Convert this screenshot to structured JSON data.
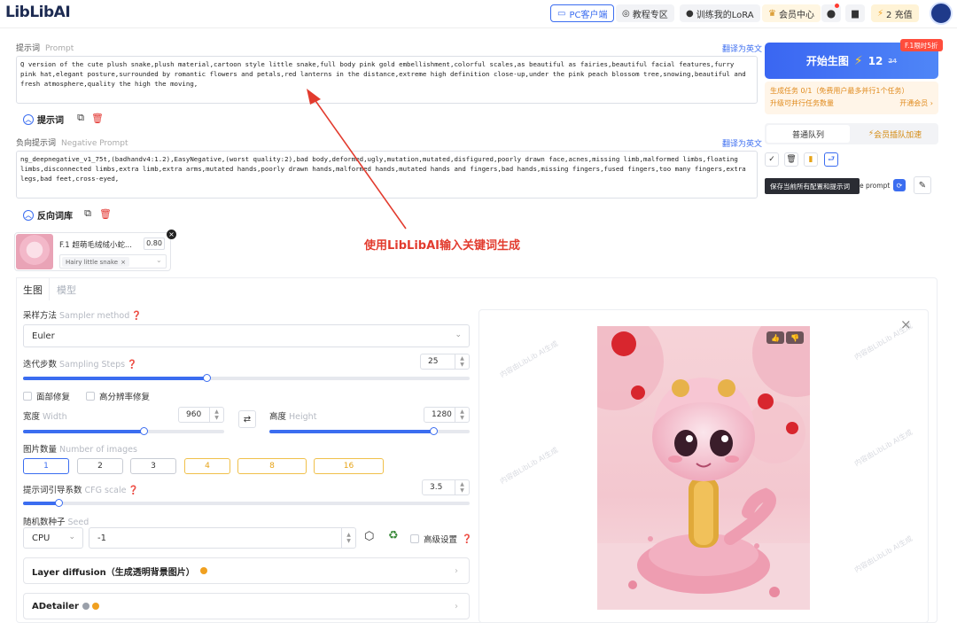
{
  "header": {
    "logo": "LibLibAI",
    "pc_client": "PC客户端",
    "tutorials": "教程专区",
    "train_lora": "训练我的LoRA",
    "member_center": "会员中心",
    "recharge": "2 充值"
  },
  "prompt": {
    "label": "提示词",
    "label_en": "Prompt",
    "translate": "翻译为英文",
    "text": "Q version of the cute plush snake,plush material,cartoon style little snake,full body pink gold embellishment,colorful scales,as beautiful as fairies,beautiful facial features,furry pink hat,elegant posture,surrounded by romantic flowers and petals,red lanterns in the distance,extreme high definition close-up,under the pink peach blossom tree,snowing,beautiful and fresh atmosphere,quality the high the moving,",
    "toolbar_label": "提示词"
  },
  "negative": {
    "label": "负向提示词",
    "label_en": "Negative Prompt",
    "translate": "翻译为英文",
    "text": "ng_deepnegative_v1_75t,(badhandv4:1.2),EasyNegative,(worst quality:2),bad body,deformed,ugly,mutation,mutated,disfigured,poorly drawn face,acnes,missing limb,malformed limbs,floating limbs,disconnected limbs,extra limb,extra arms,mutated hands,poorly drawn hands,malformed hands,mutated hands and fingers,bad hands,missing fingers,fused fingers,too many fingers,extra legs,bad feet,cross-eyed,",
    "toolbar_label": "反向词库"
  },
  "lora": {
    "name": "F.1 超萌毛绒绒小蛇...",
    "weight": "0.80",
    "tag": "Hairy little snake"
  },
  "tabs": [
    "生图",
    "模型"
  ],
  "params": {
    "sampler_label": "采样方法",
    "sampler_label_en": "Sampler method",
    "sampler_value": "Euler",
    "steps_label": "迭代步数",
    "steps_label_en": "Sampling Steps",
    "steps_value": "25",
    "steps_fraction": 0.41,
    "face_fix": "面部修复",
    "hires_fix": "高分辨率修复",
    "width_label": "宽度",
    "width_label_en": "Width",
    "width_value": "960",
    "width_fraction": 0.6,
    "height_label": "高度",
    "height_label_en": "Height",
    "height_value": "1280",
    "height_fraction": 0.82,
    "count_label": "图片数量",
    "count_label_en": "Number of images",
    "counts": [
      "1",
      "2",
      "3",
      "4",
      "8",
      "16"
    ],
    "cfg_label": "提示词引导系数",
    "cfg_label_en": "CFG scale",
    "cfg_value": "3.5",
    "cfg_fraction": 0.08,
    "seed_label": "随机数种子",
    "seed_label_en": "Seed",
    "seed_device": "CPU",
    "seed_value": "-1",
    "advanced": "高级设置",
    "layer_diffusion": "Layer diffusion（生成透明背景图片）",
    "adetailer": "ADetailer"
  },
  "right": {
    "generate": "开始生图",
    "cost": "12",
    "cost_sub": "24",
    "sale_tag": "F.1限时5折",
    "task_line": "生成任务 0/1（免费用户最多并行1个任务）",
    "task_upgrade": "升级可并行任务数量",
    "open_member": "开通会员 ›",
    "queue_normal": "普通队列",
    "queue_vip": "会员插队加速",
    "tooltip": "保存当前所有配置和提示词",
    "save_prompt_tail": "e prompt"
  },
  "annotation": "使用LibLibAI输入关键词生成",
  "watermark": "内容由LibLib AI生成",
  "colors": {
    "accent": "#3b6df0",
    "annotation": "#e23b2e",
    "gold": "#f0c04a"
  }
}
